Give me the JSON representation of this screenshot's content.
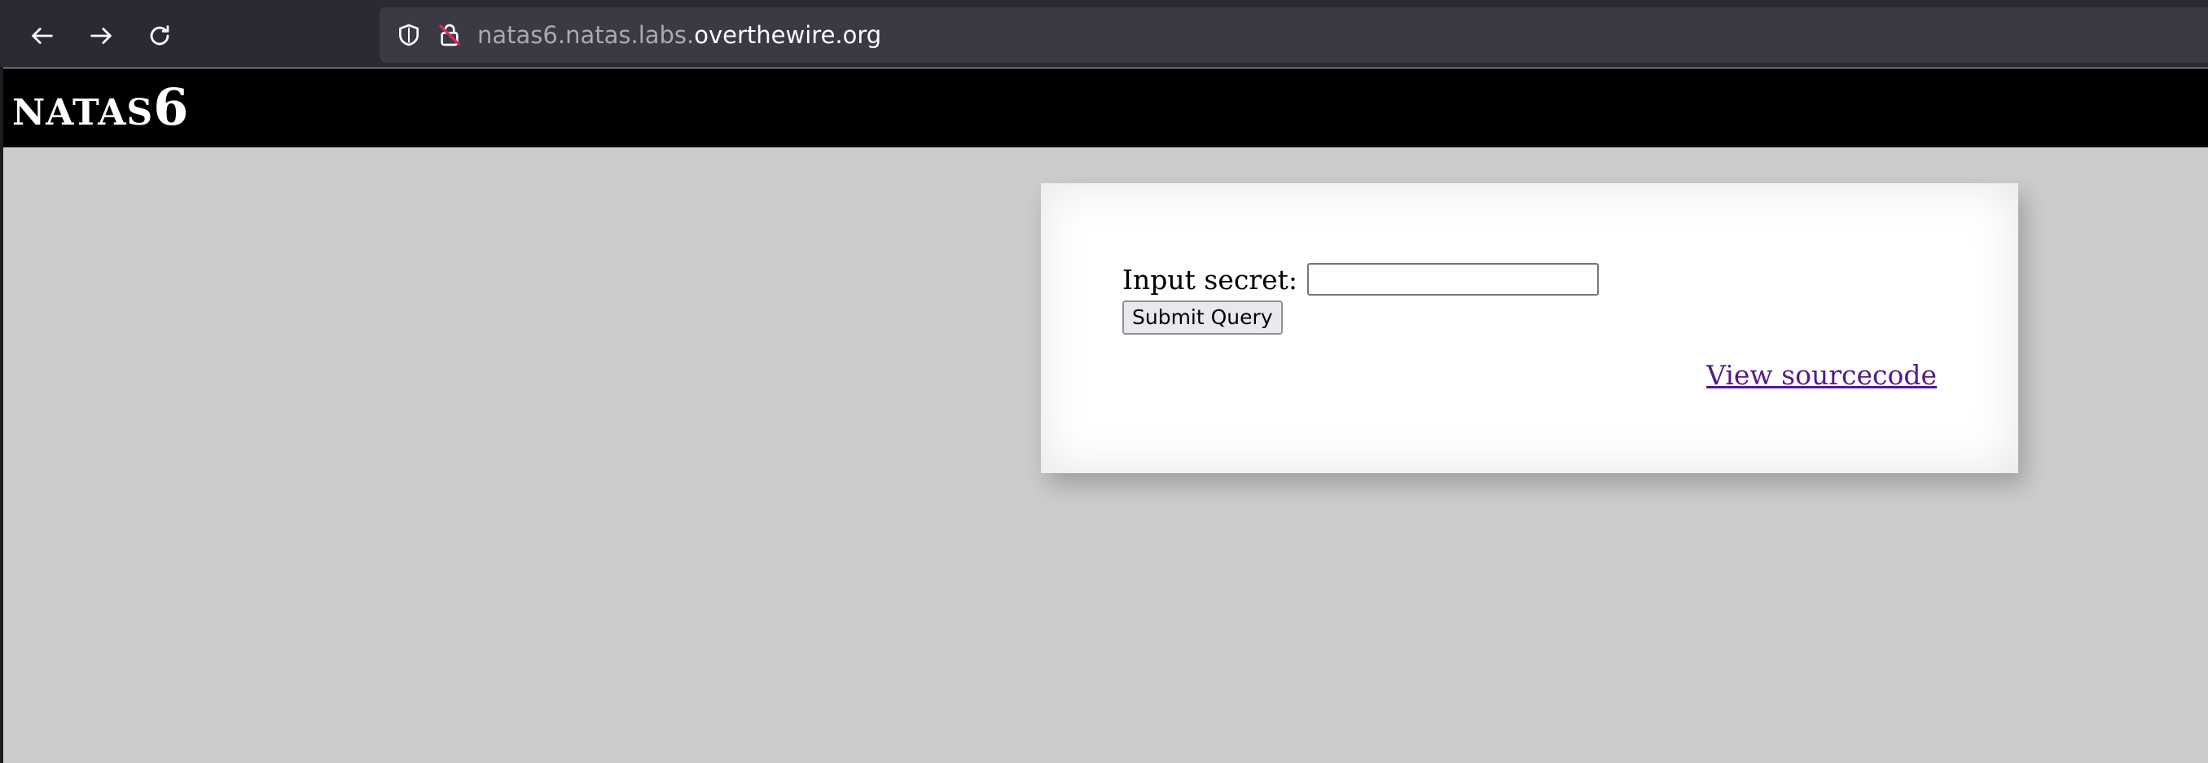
{
  "browser": {
    "url_subdomain": "natas6.natas.labs.",
    "url_domain": "overthewire.org"
  },
  "header": {
    "title_prefix": "NATAS",
    "title_number": "6"
  },
  "form": {
    "label": "Input secret:",
    "input_value": "",
    "submit_label": "Submit Query"
  },
  "links": {
    "view_source": "View sourcecode"
  }
}
